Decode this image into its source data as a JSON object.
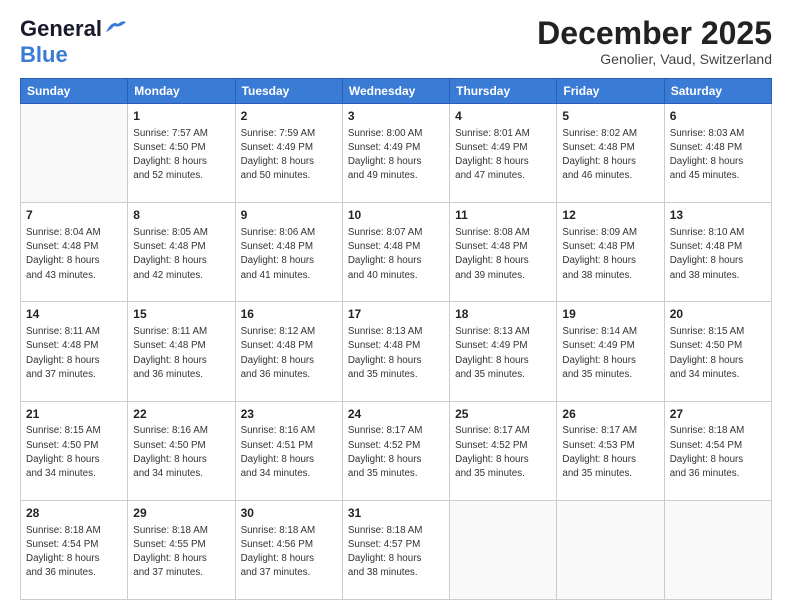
{
  "header": {
    "logo_general": "General",
    "logo_blue": "Blue",
    "month_title": "December 2025",
    "location": "Genolier, Vaud, Switzerland"
  },
  "days_of_week": [
    "Sunday",
    "Monday",
    "Tuesday",
    "Wednesday",
    "Thursday",
    "Friday",
    "Saturday"
  ],
  "weeks": [
    [
      {
        "day": "",
        "info": ""
      },
      {
        "day": "1",
        "info": "Sunrise: 7:57 AM\nSunset: 4:50 PM\nDaylight: 8 hours\nand 52 minutes."
      },
      {
        "day": "2",
        "info": "Sunrise: 7:59 AM\nSunset: 4:49 PM\nDaylight: 8 hours\nand 50 minutes."
      },
      {
        "day": "3",
        "info": "Sunrise: 8:00 AM\nSunset: 4:49 PM\nDaylight: 8 hours\nand 49 minutes."
      },
      {
        "day": "4",
        "info": "Sunrise: 8:01 AM\nSunset: 4:49 PM\nDaylight: 8 hours\nand 47 minutes."
      },
      {
        "day": "5",
        "info": "Sunrise: 8:02 AM\nSunset: 4:48 PM\nDaylight: 8 hours\nand 46 minutes."
      },
      {
        "day": "6",
        "info": "Sunrise: 8:03 AM\nSunset: 4:48 PM\nDaylight: 8 hours\nand 45 minutes."
      }
    ],
    [
      {
        "day": "7",
        "info": "Sunrise: 8:04 AM\nSunset: 4:48 PM\nDaylight: 8 hours\nand 43 minutes."
      },
      {
        "day": "8",
        "info": "Sunrise: 8:05 AM\nSunset: 4:48 PM\nDaylight: 8 hours\nand 42 minutes."
      },
      {
        "day": "9",
        "info": "Sunrise: 8:06 AM\nSunset: 4:48 PM\nDaylight: 8 hours\nand 41 minutes."
      },
      {
        "day": "10",
        "info": "Sunrise: 8:07 AM\nSunset: 4:48 PM\nDaylight: 8 hours\nand 40 minutes."
      },
      {
        "day": "11",
        "info": "Sunrise: 8:08 AM\nSunset: 4:48 PM\nDaylight: 8 hours\nand 39 minutes."
      },
      {
        "day": "12",
        "info": "Sunrise: 8:09 AM\nSunset: 4:48 PM\nDaylight: 8 hours\nand 38 minutes."
      },
      {
        "day": "13",
        "info": "Sunrise: 8:10 AM\nSunset: 4:48 PM\nDaylight: 8 hours\nand 38 minutes."
      }
    ],
    [
      {
        "day": "14",
        "info": "Sunrise: 8:11 AM\nSunset: 4:48 PM\nDaylight: 8 hours\nand 37 minutes."
      },
      {
        "day": "15",
        "info": "Sunrise: 8:11 AM\nSunset: 4:48 PM\nDaylight: 8 hours\nand 36 minutes."
      },
      {
        "day": "16",
        "info": "Sunrise: 8:12 AM\nSunset: 4:48 PM\nDaylight: 8 hours\nand 36 minutes."
      },
      {
        "day": "17",
        "info": "Sunrise: 8:13 AM\nSunset: 4:48 PM\nDaylight: 8 hours\nand 35 minutes."
      },
      {
        "day": "18",
        "info": "Sunrise: 8:13 AM\nSunset: 4:49 PM\nDaylight: 8 hours\nand 35 minutes."
      },
      {
        "day": "19",
        "info": "Sunrise: 8:14 AM\nSunset: 4:49 PM\nDaylight: 8 hours\nand 35 minutes."
      },
      {
        "day": "20",
        "info": "Sunrise: 8:15 AM\nSunset: 4:50 PM\nDaylight: 8 hours\nand 34 minutes."
      }
    ],
    [
      {
        "day": "21",
        "info": "Sunrise: 8:15 AM\nSunset: 4:50 PM\nDaylight: 8 hours\nand 34 minutes."
      },
      {
        "day": "22",
        "info": "Sunrise: 8:16 AM\nSunset: 4:50 PM\nDaylight: 8 hours\nand 34 minutes."
      },
      {
        "day": "23",
        "info": "Sunrise: 8:16 AM\nSunset: 4:51 PM\nDaylight: 8 hours\nand 34 minutes."
      },
      {
        "day": "24",
        "info": "Sunrise: 8:17 AM\nSunset: 4:52 PM\nDaylight: 8 hours\nand 35 minutes."
      },
      {
        "day": "25",
        "info": "Sunrise: 8:17 AM\nSunset: 4:52 PM\nDaylight: 8 hours\nand 35 minutes."
      },
      {
        "day": "26",
        "info": "Sunrise: 8:17 AM\nSunset: 4:53 PM\nDaylight: 8 hours\nand 35 minutes."
      },
      {
        "day": "27",
        "info": "Sunrise: 8:18 AM\nSunset: 4:54 PM\nDaylight: 8 hours\nand 36 minutes."
      }
    ],
    [
      {
        "day": "28",
        "info": "Sunrise: 8:18 AM\nSunset: 4:54 PM\nDaylight: 8 hours\nand 36 minutes."
      },
      {
        "day": "29",
        "info": "Sunrise: 8:18 AM\nSunset: 4:55 PM\nDaylight: 8 hours\nand 37 minutes."
      },
      {
        "day": "30",
        "info": "Sunrise: 8:18 AM\nSunset: 4:56 PM\nDaylight: 8 hours\nand 37 minutes."
      },
      {
        "day": "31",
        "info": "Sunrise: 8:18 AM\nSunset: 4:57 PM\nDaylight: 8 hours\nand 38 minutes."
      },
      {
        "day": "",
        "info": ""
      },
      {
        "day": "",
        "info": ""
      },
      {
        "day": "",
        "info": ""
      }
    ]
  ]
}
